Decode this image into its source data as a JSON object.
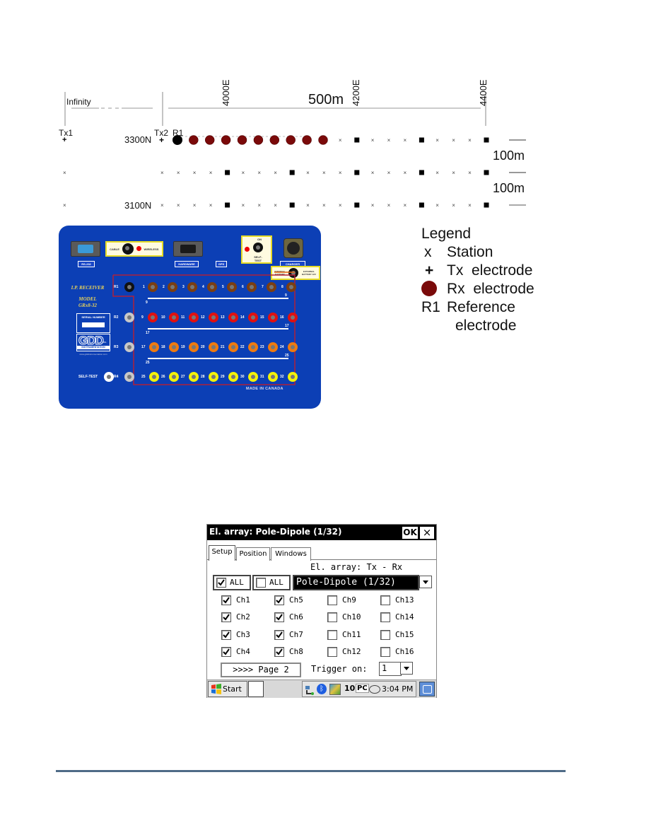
{
  "survey": {
    "infinity_label": "Infinity",
    "distance_label": "500m",
    "tx1_label": "Tx1",
    "tx2_label": "Tx2",
    "r1_label": "R1",
    "easting_labels": [
      "4000E",
      "4200E",
      "4400E"
    ],
    "northing_labels": [
      "3300N",
      "3100N"
    ],
    "spacing_labels": [
      "100m",
      "100m"
    ],
    "rx_electrode_count": 9,
    "colors": {
      "rx_electrode": "#7a0a0a",
      "reference": "#000000",
      "line": "#9a9a9a"
    }
  },
  "panel": {
    "colors": {
      "background": "#0c3fb5",
      "frame": "#b0203a"
    },
    "top_tags": [
      "RS-232",
      "HARDWARE",
      "GPS",
      "CHARGER"
    ],
    "cable_label": "CABLE",
    "wireless_label": "WIRELESS",
    "on_label": "ON",
    "off_label": "OFF",
    "selftest_small": "SELF-TEST",
    "internal_battery": "INTERNAL BATTERY",
    "external_battery": "EXTERNAL BATTERY 12V",
    "ip_receiver": "I.P. RECEIVER",
    "model_line1": "MODEL",
    "model_line2": "GRx8-32",
    "serial_number": "SERIAL NUMBER",
    "brand": "GDD",
    "brand_inc": "inc.",
    "brand_sub": "INSTRUMENTATION",
    "website": "www.gddinstrumentation.com",
    "self_test": "SELF-TEST",
    "made_in": "MADE IN CANADA",
    "reference_labels": [
      "R1",
      "R2",
      "R3",
      "R4"
    ],
    "row_colors": [
      "#7a3e12",
      "#e01010",
      "#ee7a10",
      "#f2f20a"
    ],
    "row_channels": [
      [
        "1",
        "2",
        "3",
        "4",
        "5",
        "6",
        "7",
        "8"
      ],
      [
        "9",
        "10",
        "11",
        "12",
        "13",
        "14",
        "15",
        "16"
      ],
      [
        "17",
        "18",
        "19",
        "20",
        "21",
        "22",
        "23",
        "24"
      ],
      [
        "25",
        "26",
        "27",
        "28",
        "29",
        "30",
        "31",
        "32"
      ]
    ],
    "continuation_labels": [
      "9",
      "17",
      "25"
    ]
  },
  "legend": {
    "title": "Legend",
    "items": [
      {
        "symbol": "x",
        "label": "Station"
      },
      {
        "symbol": "+",
        "label": "Tx  electrode"
      },
      {
        "symbol": "rx-dot",
        "label": "Rx  electrode"
      },
      {
        "symbol": "R1",
        "label": "Reference"
      }
    ],
    "continuation": "electrode"
  },
  "pda": {
    "title": "El. array: Pole-Dipole (1/32)",
    "ok_label": "OK",
    "close_label": "×",
    "tabs": [
      "Setup",
      "Position",
      "Windows"
    ],
    "active_tab": "Setup",
    "array_label": "El. array: Tx - Rx",
    "all_checked_label": "ALL",
    "all_unchecked_label": "ALL",
    "array_value": "Pole-Dipole (1/32)",
    "channels": [
      {
        "label": "Ch1",
        "checked": true
      },
      {
        "label": "Ch2",
        "checked": true
      },
      {
        "label": "Ch3",
        "checked": true
      },
      {
        "label": "Ch4",
        "checked": true
      },
      {
        "label": "Ch5",
        "checked": true
      },
      {
        "label": "Ch6",
        "checked": true
      },
      {
        "label": "Ch7",
        "checked": true
      },
      {
        "label": "Ch8",
        "checked": true
      },
      {
        "label": "Ch9",
        "checked": false
      },
      {
        "label": "Ch10",
        "checked": false
      },
      {
        "label": "Ch11",
        "checked": false
      },
      {
        "label": "Ch12",
        "checked": false
      },
      {
        "label": "Ch13",
        "checked": false
      },
      {
        "label": "Ch14",
        "checked": false
      },
      {
        "label": "Ch15",
        "checked": false
      },
      {
        "label": "Ch16",
        "checked": false
      }
    ],
    "page_button": ">>>> Page 2",
    "trigger_label": "Trigger on:",
    "trigger_value": "1",
    "taskbar": {
      "start_label": "Start",
      "time": "3:04 PM",
      "tray_icons": [
        "network-icon",
        "bluetooth-icon",
        "app-icon",
        "io-icon",
        "pc-icon",
        "sync-icon"
      ]
    }
  }
}
